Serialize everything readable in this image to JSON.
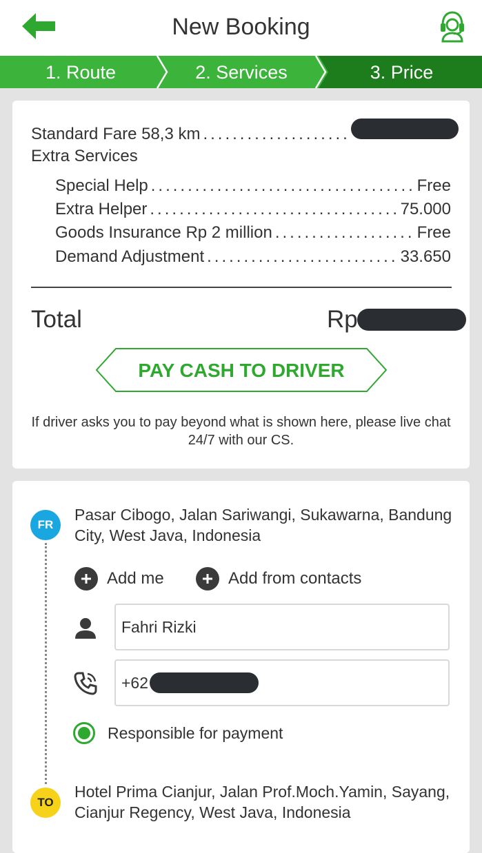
{
  "header": {
    "title": "New Booking",
    "icons": {
      "back": "arrow-left-icon",
      "support": "headset-support-icon"
    },
    "accent_color": "#2fa82f"
  },
  "steps": {
    "items": [
      {
        "label": "1. Route"
      },
      {
        "label": "2. Services"
      },
      {
        "label": "3. Price"
      }
    ],
    "active_index": 2,
    "colors": {
      "inactive": "#3cb43c",
      "active": "#1d7d1d"
    }
  },
  "price": {
    "standard_fare_label": "Standard Fare 58,3 km",
    "extra_services_title": "Extra Services",
    "extras": [
      {
        "label": "Special Help",
        "value": "Free"
      },
      {
        "label": "Extra Helper",
        "value": "75.000"
      },
      {
        "label": "Goods Insurance Rp 2 million",
        "value": "Free"
      },
      {
        "label": "Demand Adjustment",
        "value": "33.650"
      }
    ],
    "total_label": "Total",
    "total_currency": "Rp",
    "pay_button": "PAY CASH TO DRIVER",
    "note": "If driver asks you to pay beyond what is shown here, please live chat 24/7 with our CS."
  },
  "route": {
    "from_badge": "FR",
    "from_address": "Pasar Cibogo, Jalan Sariwangi, Sukawarna, Bandung City, West Java, Indonesia",
    "add_me": "Add me",
    "add_from_contacts": "Add from contacts",
    "name_value": "Fahri Rizki",
    "phone_prefix": "+62",
    "responsible_label": "Responsible for payment",
    "to_badge": "TO",
    "to_address": "Hotel Prima Cianjur, Jalan Prof.Moch.Yamin, Sayang, Cianjur Regency, West Java, Indonesia"
  }
}
